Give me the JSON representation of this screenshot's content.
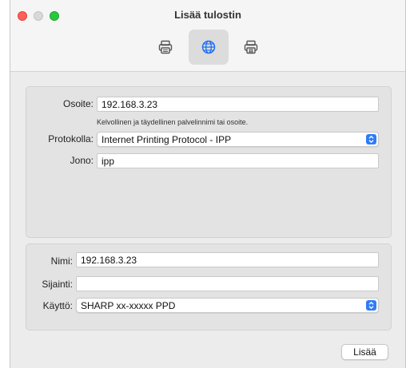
{
  "window": {
    "title": "Lisää tulostin"
  },
  "toolbar": {
    "items": [
      {
        "icon": "printer-icon",
        "selected": false
      },
      {
        "icon": "globe-icon",
        "selected": true
      },
      {
        "icon": "printer-windows-icon",
        "selected": false
      }
    ]
  },
  "network": {
    "address_label": "Osoite:",
    "address_value": "192.168.3.23",
    "address_hint": "Kelvollinen ja täydellinen palvelinnimi tai osoite.",
    "protocol_label": "Protokolla:",
    "protocol_value": "Internet Printing Protocol - IPP",
    "queue_label": "Jono:",
    "queue_value": "ipp"
  },
  "printer": {
    "name_label": "Nimi:",
    "name_value": "192.168.3.23",
    "location_label": "Sijainti:",
    "location_value": "",
    "use_label": "Käyttö:",
    "use_value": "SHARP xx-xxxxx PPD"
  },
  "actions": {
    "add_label": "Lisää"
  },
  "colors": {
    "accent": "#2f7cf6",
    "close": "#ff5f57",
    "zoom": "#28c840"
  }
}
